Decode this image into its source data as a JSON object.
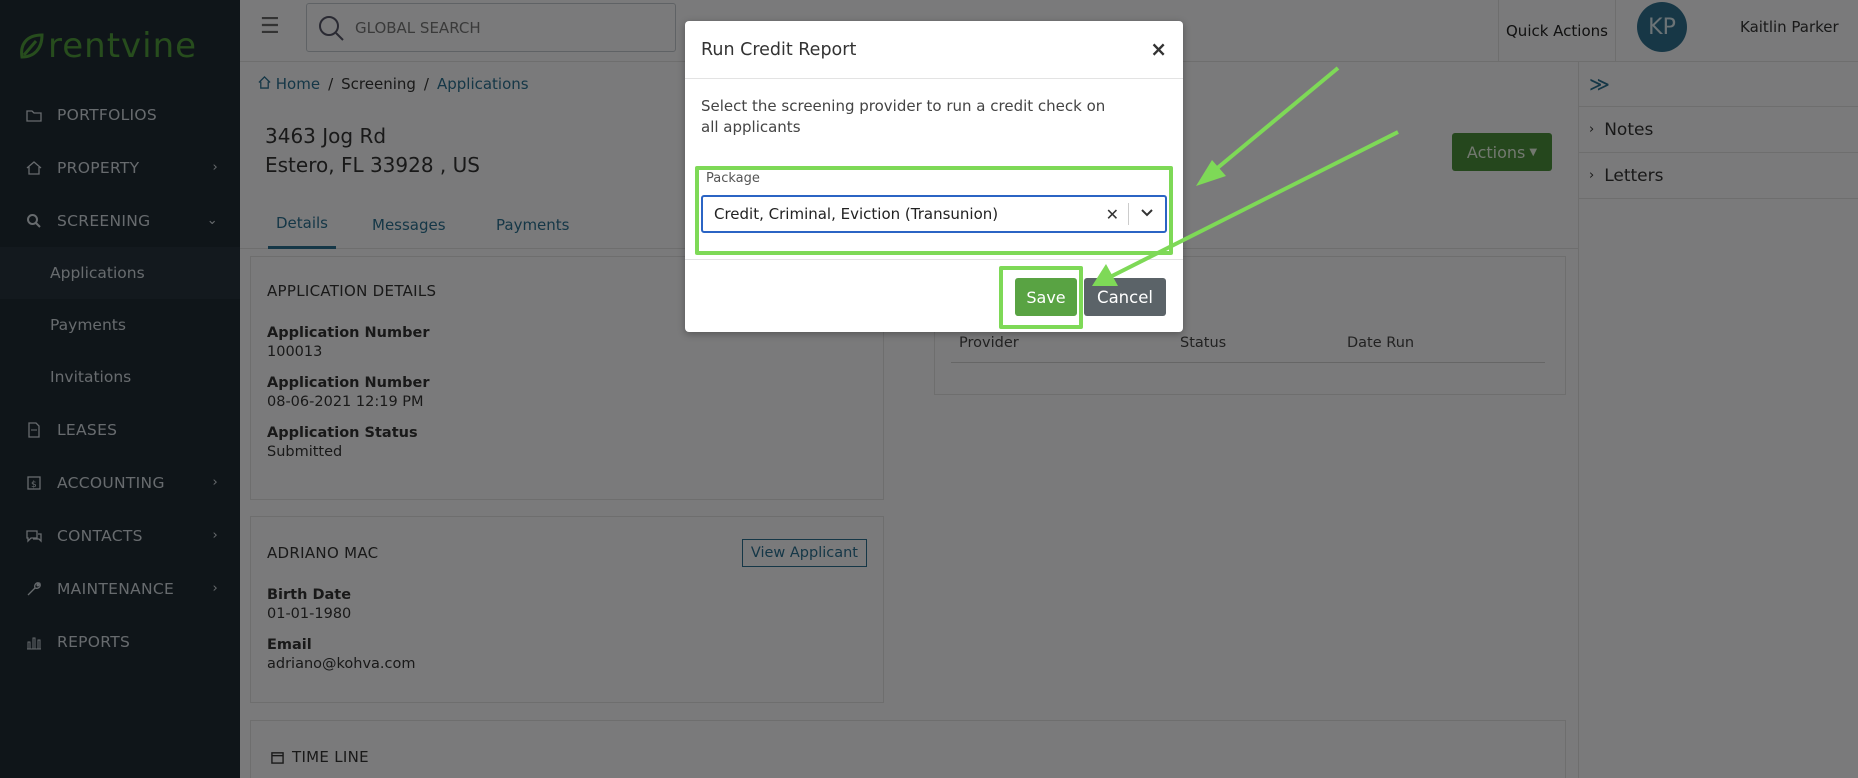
{
  "brand": {
    "name": "rentvine",
    "color": "#4e9a3b"
  },
  "sidebar": {
    "items": [
      {
        "label": "PORTFOLIOS",
        "icon": "folder-icon",
        "has_chevron": false
      },
      {
        "label": "PROPERTY",
        "icon": "home-icon",
        "has_chevron": true
      },
      {
        "label": "SCREENING",
        "icon": "search-icon",
        "has_chevron": true,
        "expanded": true
      },
      {
        "label": "LEASES",
        "icon": "document-icon",
        "has_chevron": false
      },
      {
        "label": "ACCOUNTING",
        "icon": "dollar-icon",
        "has_chevron": true
      },
      {
        "label": "CONTACTS",
        "icon": "chat-icon",
        "has_chevron": true
      },
      {
        "label": "MAINTENANCE",
        "icon": "wrench-icon",
        "has_chevron": true
      },
      {
        "label": "REPORTS",
        "icon": "chart-icon",
        "has_chevron": false
      }
    ],
    "screening_sub": [
      "Applications",
      "Payments",
      "Invitations"
    ],
    "chevron_right": "›",
    "chevron_down": "⌄"
  },
  "topbar": {
    "search_placeholder": "GLOBAL SEARCH",
    "quick_actions": "Quick Actions",
    "avatar_initials": "KP",
    "user_name": "Kaitlin Parker"
  },
  "breadcrumb": {
    "home": "Home",
    "sep": "/",
    "screening": "Screening",
    "applications": "Applications"
  },
  "address": {
    "line1": "3463 Jog Rd",
    "line2": "Estero, FL 33928 , US"
  },
  "tabs": [
    "Details",
    "Messages",
    "Payments"
  ],
  "actions_label": "Actions",
  "app_details": {
    "title": "APPLICATION DETAILS",
    "fields": [
      {
        "label": "Application Number",
        "value": "100013"
      },
      {
        "label": "Application Number",
        "value": "08-06-2021 12:19 PM"
      },
      {
        "label": "Application Status",
        "value": "Submitted"
      }
    ]
  },
  "applicant": {
    "name": "ADRIANO MAC",
    "view_label": "View Applicant",
    "fields": [
      {
        "label": "Birth Date",
        "value": "01-01-1980"
      },
      {
        "label": "Email",
        "value": "adriano@kohva.com"
      }
    ]
  },
  "reports_table": {
    "columns": [
      "Provider",
      "Status",
      "Date Run"
    ]
  },
  "timeline": {
    "title": "TIME LINE"
  },
  "right_panel": {
    "items": [
      "Notes",
      "Letters"
    ]
  },
  "modal": {
    "title": "Run Credit Report",
    "close": "×",
    "description": "Select the screening provider to run a credit check on all applicants",
    "package_label": "Package",
    "package_value": "Credit, Criminal, Eviction (Transunion)",
    "clear": "✕",
    "save": "Save",
    "cancel": "Cancel"
  },
  "highlight_color": "#7ed957"
}
